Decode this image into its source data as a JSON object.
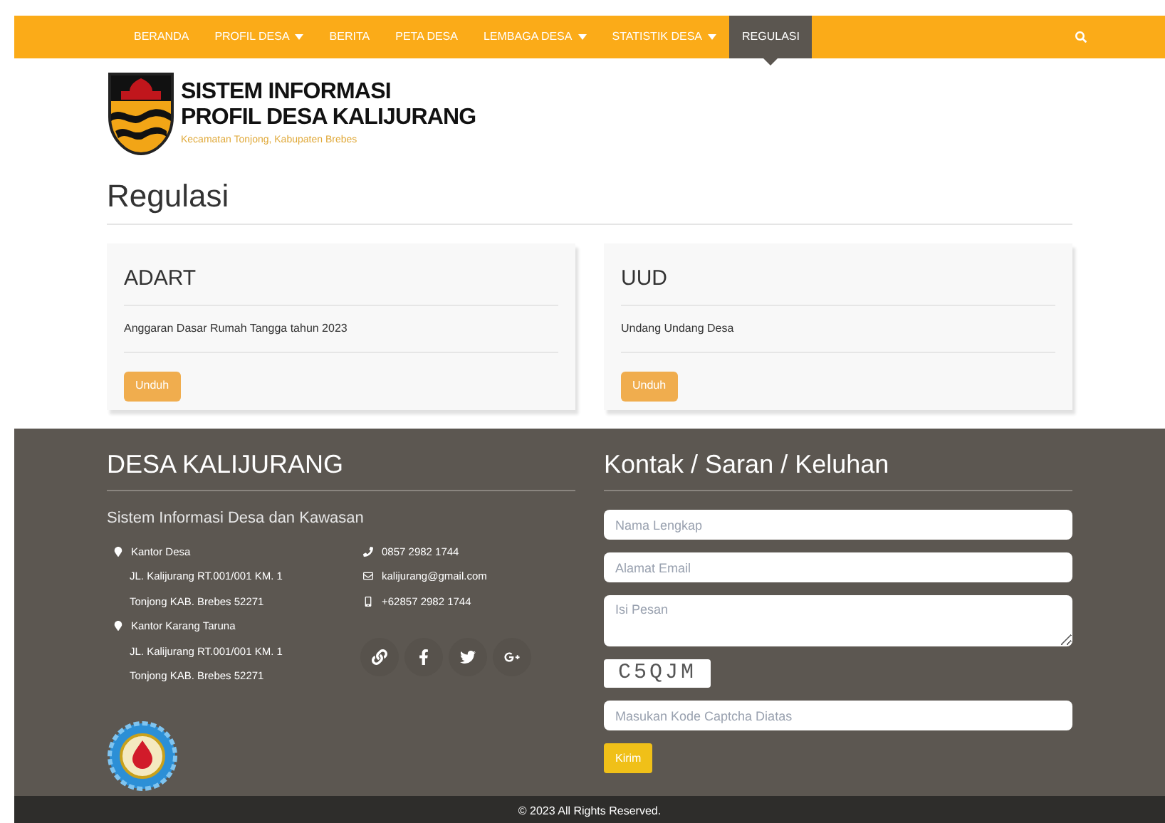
{
  "nav": {
    "items": [
      {
        "label": "BERANDA",
        "dropdown": false,
        "selected": false
      },
      {
        "label": "PROFIL DESA",
        "dropdown": true,
        "selected": false
      },
      {
        "label": "BERITA",
        "dropdown": false,
        "selected": false
      },
      {
        "label": "PETA DESA",
        "dropdown": false,
        "selected": false
      },
      {
        "label": "LEMBAGA DESA",
        "dropdown": true,
        "selected": false
      },
      {
        "label": "STATISTIK DESA",
        "dropdown": true,
        "selected": false
      },
      {
        "label": "REGULASI",
        "dropdown": false,
        "selected": true
      }
    ]
  },
  "brand": {
    "title_lines": [
      "SISTEM INFORMASI",
      "PROFIL DESA KALIJURANG"
    ],
    "subtitle": "Kecamatan Tonjong, Kabupaten Brebes"
  },
  "page_title": "Regulasi",
  "documents": [
    {
      "title": "ADART",
      "description": "Anggaran Dasar Rumah Tangga tahun 2023",
      "button": "Unduh"
    },
    {
      "title": "UUD",
      "description": "Undang Undang Desa",
      "button": "Unduh"
    }
  ],
  "footer": {
    "title": "DESA KALIJURANG",
    "subtitle": "Sistem Informasi Desa dan Kawasan",
    "offices": [
      {
        "name": "Kantor Desa",
        "lines": [
          "JL. Kalijurang RT.001/001 KM. 1",
          "Tonjong KAB. Brebes 52271"
        ]
      },
      {
        "name": "Kantor Karang Taruna",
        "lines": [
          "JL. Kalijurang RT.001/001 KM. 1",
          "Tonjong KAB. Brebes 52271"
        ]
      }
    ],
    "contacts": [
      {
        "kind": "phone",
        "text": "0857 2982 1744"
      },
      {
        "kind": "email",
        "text": "kalijurang@gmail.com"
      },
      {
        "kind": "mobile",
        "text": "+62857 2982 1744"
      }
    ]
  },
  "contact_form": {
    "title": "Kontak / Saran / Keluhan",
    "fields": [
      {
        "kind": "input",
        "placeholder": "Nama Lengkap"
      },
      {
        "kind": "input",
        "placeholder": "Alamat Email"
      },
      {
        "kind": "textarea",
        "placeholder": "Isi Pesan"
      }
    ],
    "captcha": "C5QJM",
    "captcha_field": {
      "placeholder": "Masukan Kode Captcha Diatas"
    },
    "submit": "Kirim"
  },
  "copyright": "© 2023 All Rights Reserved."
}
